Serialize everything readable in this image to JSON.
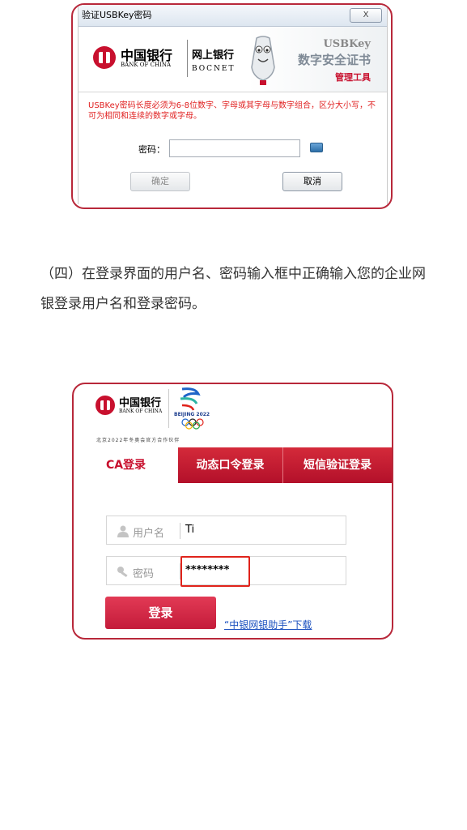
{
  "usbkey_dialog": {
    "window_title": "验证USBKey密码",
    "close_symbol": "X",
    "bank_name_cn": "中国银行",
    "bank_name_en": "BANK OF CHINA",
    "bocnet_cn": "网上银行",
    "bocnet_en": "BOCNET",
    "cert_title_en": "USBKey",
    "cert_title_cn": "数字安全证书",
    "cert_subtitle": "管理工具",
    "warning_text": "USBKey密码长度必须为6-8位数字、字母或其字母与数字组合，区分大小写，不可为相同和连续的数字或字母。",
    "password_label": "密码：",
    "password_value": "",
    "confirm_label": "确定",
    "cancel_label": "取消"
  },
  "instruction": {
    "text": "（四）在登录界面的用户名、密码输入框中正确输入您的企业网银登录用户名和登录密码。"
  },
  "login_page": {
    "bank_name_cn": "中国银行",
    "bank_name_en": "BANK OF CHINA",
    "olympic_text": "BEIJING 2022",
    "partner_text": "北京2022年冬奥会官方合作伙伴",
    "tabs": [
      {
        "label": "CA登录"
      },
      {
        "label": "动态口令登录"
      },
      {
        "label": "短信验证登录"
      }
    ],
    "username_label": "用户名",
    "username_value": "Ti",
    "password_label": "密码",
    "password_value": "********",
    "login_button": "登录",
    "helper_link": "“中银网银助手”下载",
    "colors": {
      "accent_red": "#c8102e",
      "highlight_box": "#e0231b",
      "link_blue": "#1a4fbf"
    }
  }
}
